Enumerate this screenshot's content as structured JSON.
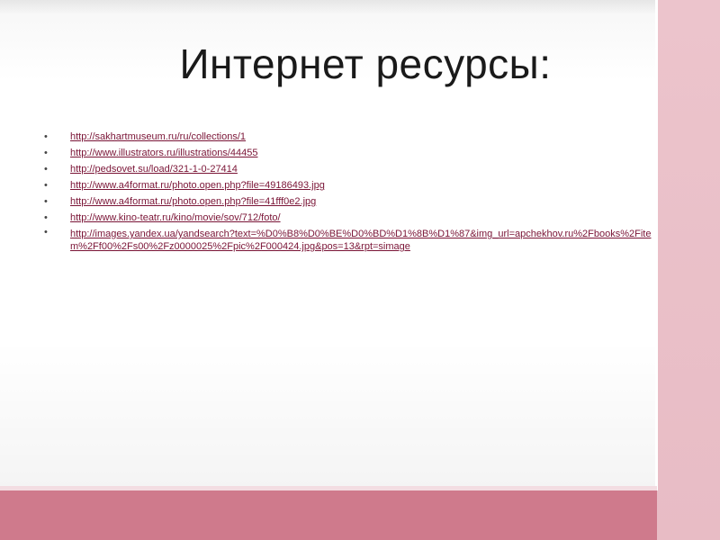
{
  "slide": {
    "title": "Интернет ресурсы:",
    "links": [
      "http://sakhartmuseum.ru/ru/collections/1",
      "http://www.illustrators.ru/illustrations/44455",
      "http://pedsovet.su/load/321-1-0-27414",
      "http://www.a4format.ru/photo.open.php?file=49186493.jpg",
      "http://www.a4format.ru/photo.open.php?file=41fff0e2.jpg",
      "http://www.kino-teatr.ru/kino/movie/sov/712/foto/",
      "http://images.yandex.ua/yandsearch?text=%D0%B8%D0%BE%D0%BD%D1%8B%D1%87&img_url=apchekhov.ru%2Fbooks%2Fitem%2Ff00%2Fs00%2Fz0000025%2Fpic%2F000424.jpg&pos=13&rpt=simage"
    ],
    "bullet_glyph": "•"
  },
  "colors": {
    "accent_pink": "#cf7a8c",
    "side_panel_pink": "#ecc4cc",
    "link_color": "#7a1436"
  }
}
